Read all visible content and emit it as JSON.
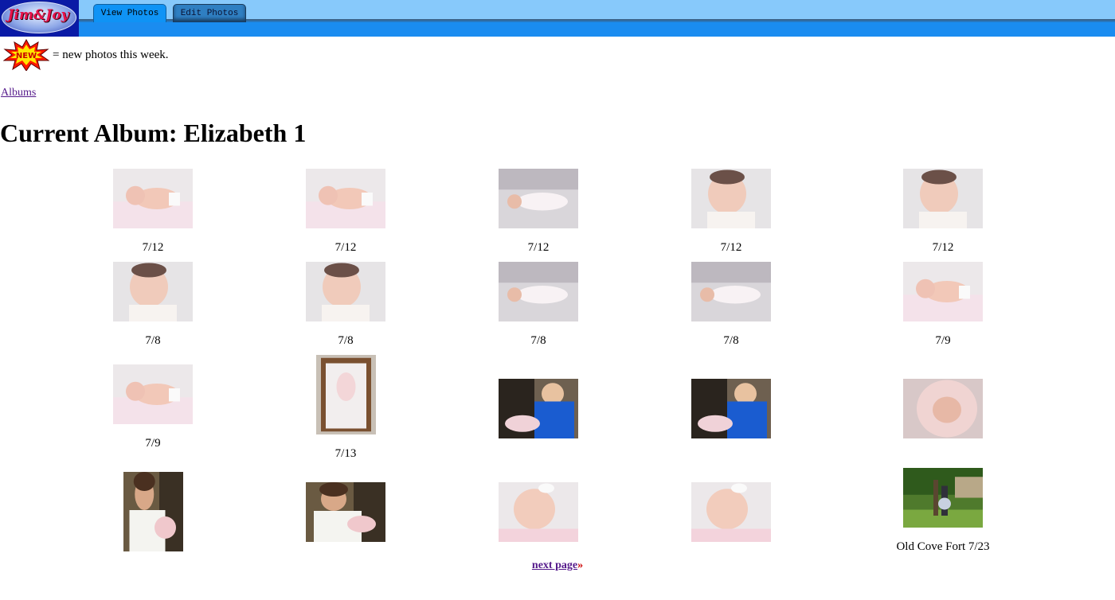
{
  "header": {
    "logo_text": "Jim&Joy",
    "tabs": [
      {
        "label": "View Photos",
        "active": true
      },
      {
        "label": "Edit Photos",
        "active": false
      }
    ],
    "colors": {
      "light": "#87c9fb",
      "band": "#1a8cf0",
      "logo_bg": "#0a1aa6"
    }
  },
  "legend": {
    "badge_text": "NEW",
    "text": "= new photos this week."
  },
  "nav": {
    "albums_link": "Albums"
  },
  "album": {
    "title": "Current Album: Elizabeth 1"
  },
  "photos": [
    {
      "caption": "7/12",
      "orientation": "landscape",
      "subject": "baby-on-blanket"
    },
    {
      "caption": "7/12",
      "orientation": "landscape",
      "subject": "baby-on-blanket"
    },
    {
      "caption": "7/12",
      "orientation": "landscape",
      "subject": "baby-lying"
    },
    {
      "caption": "7/12",
      "orientation": "landscape",
      "subject": "baby-face"
    },
    {
      "caption": "7/12",
      "orientation": "landscape",
      "subject": "baby-face"
    },
    {
      "caption": "7/8",
      "orientation": "landscape",
      "subject": "baby-face"
    },
    {
      "caption": "7/8",
      "orientation": "landscape",
      "subject": "baby-face"
    },
    {
      "caption": "7/8",
      "orientation": "landscape",
      "subject": "baby-lying"
    },
    {
      "caption": "7/8",
      "orientation": "landscape",
      "subject": "baby-lying"
    },
    {
      "caption": "7/9",
      "orientation": "landscape",
      "subject": "baby-on-blanket"
    },
    {
      "caption": "7/9",
      "orientation": "landscape",
      "subject": "baby-on-blanket"
    },
    {
      "caption": "7/13",
      "orientation": "portrait",
      "subject": "baby-in-crib"
    },
    {
      "caption": "",
      "orientation": "landscape",
      "subject": "person-holding-baby"
    },
    {
      "caption": "",
      "orientation": "landscape",
      "subject": "person-holding-baby"
    },
    {
      "caption": "",
      "orientation": "landscape",
      "subject": "baby-in-hood"
    },
    {
      "caption": "",
      "orientation": "portrait",
      "subject": "woman-holding-baby"
    },
    {
      "caption": "",
      "orientation": "landscape",
      "subject": "woman-holding-baby"
    },
    {
      "caption": "",
      "orientation": "landscape",
      "subject": "baby-sleeping"
    },
    {
      "caption": "",
      "orientation": "landscape",
      "subject": "baby-sleeping"
    },
    {
      "caption": "Old Cove Fort 7/23",
      "orientation": "landscape",
      "subject": "outdoor-family"
    }
  ],
  "pagination": {
    "next_label": "next page",
    "arrow": "»"
  }
}
